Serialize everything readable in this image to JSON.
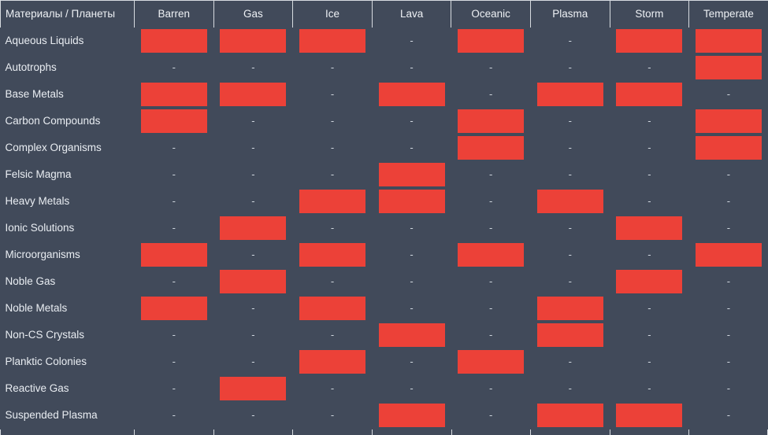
{
  "header": {
    "corner_label": "Материалы / Планеты",
    "columns": [
      "Barren",
      "Gas",
      "Ice",
      "Lava",
      "Oceanic",
      "Plasma",
      "Storm",
      "Temperate"
    ]
  },
  "colors": {
    "background": "#414a5a",
    "bar": "#ec4138",
    "grid_line": "#d7dbe0",
    "text": "#e9edf2"
  },
  "empty_marker": "-",
  "chart_data": {
    "type": "heatmap",
    "title": "Материалы / Планеты",
    "xlabel": "",
    "ylabel": "",
    "grid": true,
    "legend": "none",
    "x_categories": [
      "Barren",
      "Gas",
      "Ice",
      "Lava",
      "Oceanic",
      "Plasma",
      "Storm",
      "Temperate"
    ],
    "y_categories": [
      "Aqueous Liquids",
      "Autotrophs",
      "Base Metals",
      "Carbon Compounds",
      "Complex Organisms",
      "Felsic Magma",
      "Heavy Metals",
      "Ionic Solutions",
      "Microorganisms",
      "Noble Gas",
      "Noble Metals",
      "Non-CS Crystals",
      "Planktic Colonies",
      "Reactive Gas",
      "Suspended Plasma"
    ],
    "values": [
      [
        1,
        1,
        1,
        0,
        1,
        0,
        1,
        1
      ],
      [
        0,
        0,
        0,
        0,
        0,
        0,
        0,
        1
      ],
      [
        1,
        1,
        0,
        1,
        0,
        1,
        1,
        0
      ],
      [
        1,
        0,
        0,
        0,
        1,
        0,
        0,
        1
      ],
      [
        0,
        0,
        0,
        0,
        1,
        0,
        0,
        1
      ],
      [
        0,
        0,
        0,
        1,
        0,
        0,
        0,
        0
      ],
      [
        0,
        0,
        1,
        1,
        0,
        1,
        0,
        0
      ],
      [
        0,
        1,
        0,
        0,
        0,
        0,
        1,
        0
      ],
      [
        1,
        0,
        1,
        0,
        1,
        0,
        0,
        1
      ],
      [
        0,
        1,
        0,
        0,
        0,
        0,
        1,
        0
      ],
      [
        1,
        0,
        1,
        0,
        0,
        1,
        0,
        0
      ],
      [
        0,
        0,
        0,
        1,
        0,
        1,
        0,
        0
      ],
      [
        0,
        0,
        1,
        0,
        1,
        0,
        0,
        0
      ],
      [
        0,
        1,
        0,
        0,
        0,
        0,
        0,
        0
      ],
      [
        0,
        0,
        0,
        1,
        0,
        1,
        1,
        0
      ]
    ]
  },
  "rows": [
    {
      "label": "Aqueous Liquids",
      "cells": [
        1,
        1,
        1,
        0,
        1,
        0,
        1,
        1
      ]
    },
    {
      "label": "Autotrophs",
      "cells": [
        0,
        0,
        0,
        0,
        0,
        0,
        0,
        1
      ]
    },
    {
      "label": "Base Metals",
      "cells": [
        1,
        1,
        0,
        1,
        0,
        1,
        1,
        0
      ]
    },
    {
      "label": "Carbon Compounds",
      "cells": [
        1,
        0,
        0,
        0,
        1,
        0,
        0,
        1
      ]
    },
    {
      "label": "Complex Organisms",
      "cells": [
        0,
        0,
        0,
        0,
        1,
        0,
        0,
        1
      ]
    },
    {
      "label": "Felsic Magma",
      "cells": [
        0,
        0,
        0,
        1,
        0,
        0,
        0,
        0
      ]
    },
    {
      "label": "Heavy Metals",
      "cells": [
        0,
        0,
        1,
        1,
        0,
        1,
        0,
        0
      ]
    },
    {
      "label": "Ionic Solutions",
      "cells": [
        0,
        1,
        0,
        0,
        0,
        0,
        1,
        0
      ]
    },
    {
      "label": "Microorganisms",
      "cells": [
        1,
        0,
        1,
        0,
        1,
        0,
        0,
        1
      ]
    },
    {
      "label": "Noble Gas",
      "cells": [
        0,
        1,
        0,
        0,
        0,
        0,
        1,
        0
      ]
    },
    {
      "label": "Noble Metals",
      "cells": [
        1,
        0,
        1,
        0,
        0,
        1,
        0,
        0
      ]
    },
    {
      "label": "Non-CS Crystals",
      "cells": [
        0,
        0,
        0,
        1,
        0,
        1,
        0,
        0
      ]
    },
    {
      "label": "Planktic Colonies",
      "cells": [
        0,
        0,
        1,
        0,
        1,
        0,
        0,
        0
      ]
    },
    {
      "label": "Reactive Gas",
      "cells": [
        0,
        1,
        0,
        0,
        0,
        0,
        0,
        0
      ]
    },
    {
      "label": "Suspended Plasma",
      "cells": [
        0,
        0,
        0,
        1,
        0,
        1,
        1,
        0
      ]
    }
  ]
}
